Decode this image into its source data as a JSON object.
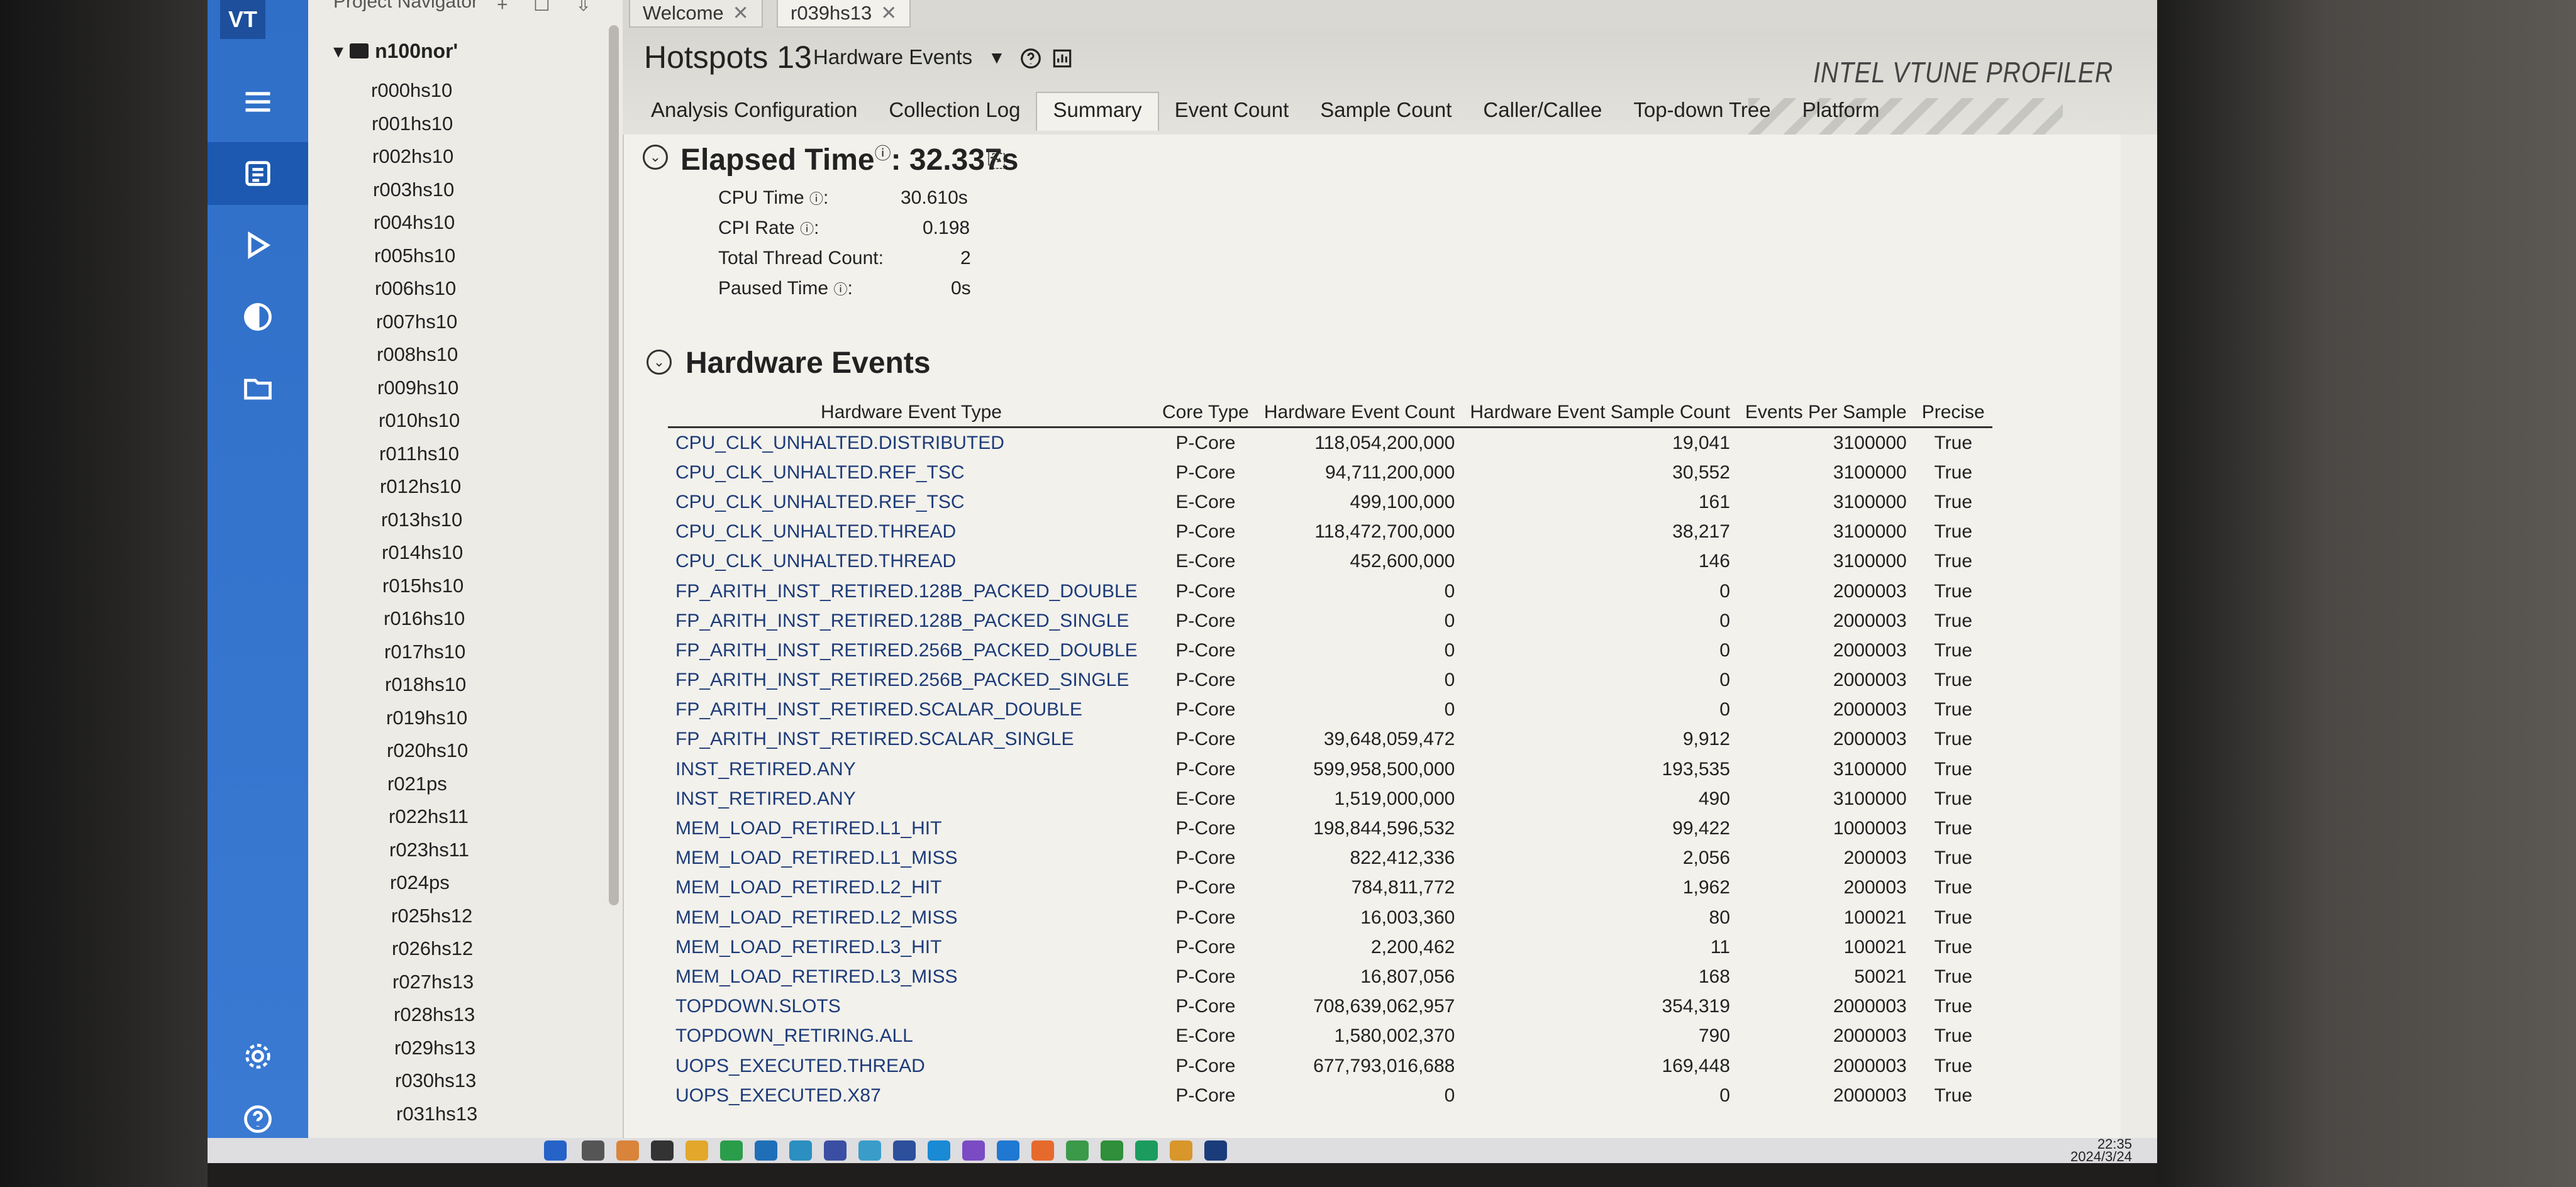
{
  "app": {
    "logo": "VT",
    "brand": "INTEL VTUNE PROFILER"
  },
  "window_tabs": [
    {
      "label": "Welcome"
    },
    {
      "label": "r039hs13"
    }
  ],
  "navigator": {
    "title": "Project Navigator",
    "root": "n100nor'",
    "results": [
      "r000hs10",
      "r001hs10",
      "r002hs10",
      "r003hs10",
      "r004hs10",
      "r005hs10",
      "r006hs10",
      "r007hs10",
      "r008hs10",
      "r009hs10",
      "r010hs10",
      "r011hs10",
      "r012hs10",
      "r013hs10",
      "r014hs10",
      "r015hs10",
      "r016hs10",
      "r017hs10",
      "r018hs10",
      "r019hs10",
      "r020hs10",
      "r021ps",
      "r022hs11",
      "r023hs11",
      "r024ps",
      "r025hs12",
      "r026hs12",
      "r027hs13",
      "r028hs13",
      "r029hs13",
      "r030hs13",
      "r031hs13"
    ]
  },
  "header": {
    "title": "Hotspots 13",
    "view_selector": "Hardware Events",
    "tabs": [
      "Analysis Configuration",
      "Collection Log",
      "Summary",
      "Event Count",
      "Sample Count",
      "Caller/Callee",
      "Top-down Tree",
      "Platform"
    ],
    "active_tab": "Summary"
  },
  "summary": {
    "elapsed_label": "Elapsed Time",
    "elapsed_value": ": 32.337s",
    "metrics": [
      {
        "label": "CPU Time",
        "value": "30.610s"
      },
      {
        "label": "CPI Rate",
        "value": "0.198"
      },
      {
        "label": "Total Thread Count:",
        "value": "2"
      },
      {
        "label": "Paused Time",
        "value": "0s"
      }
    ]
  },
  "hardware_events": {
    "title": "Hardware Events",
    "columns": [
      "Hardware Event Type",
      "Core Type",
      "Hardware Event Count",
      "Hardware Event Sample Count",
      "Events Per Sample",
      "Precise"
    ],
    "rows": [
      [
        "CPU_CLK_UNHALTED.DISTRIBUTED",
        "P-Core",
        "118,054,200,000",
        "19,041",
        "3100000",
        "True"
      ],
      [
        "CPU_CLK_UNHALTED.REF_TSC",
        "P-Core",
        "94,711,200,000",
        "30,552",
        "3100000",
        "True"
      ],
      [
        "CPU_CLK_UNHALTED.REF_TSC",
        "E-Core",
        "499,100,000",
        "161",
        "3100000",
        "True"
      ],
      [
        "CPU_CLK_UNHALTED.THREAD",
        "P-Core",
        "118,472,700,000",
        "38,217",
        "3100000",
        "True"
      ],
      [
        "CPU_CLK_UNHALTED.THREAD",
        "E-Core",
        "452,600,000",
        "146",
        "3100000",
        "True"
      ],
      [
        "FP_ARITH_INST_RETIRED.128B_PACKED_DOUBLE",
        "P-Core",
        "0",
        "0",
        "2000003",
        "True"
      ],
      [
        "FP_ARITH_INST_RETIRED.128B_PACKED_SINGLE",
        "P-Core",
        "0",
        "0",
        "2000003",
        "True"
      ],
      [
        "FP_ARITH_INST_RETIRED.256B_PACKED_DOUBLE",
        "P-Core",
        "0",
        "0",
        "2000003",
        "True"
      ],
      [
        "FP_ARITH_INST_RETIRED.256B_PACKED_SINGLE",
        "P-Core",
        "0",
        "0",
        "2000003",
        "True"
      ],
      [
        "FP_ARITH_INST_RETIRED.SCALAR_DOUBLE",
        "P-Core",
        "0",
        "0",
        "2000003",
        "True"
      ],
      [
        "FP_ARITH_INST_RETIRED.SCALAR_SINGLE",
        "P-Core",
        "39,648,059,472",
        "9,912",
        "2000003",
        "True"
      ],
      [
        "INST_RETIRED.ANY",
        "P-Core",
        "599,958,500,000",
        "193,535",
        "3100000",
        "True"
      ],
      [
        "INST_RETIRED.ANY",
        "E-Core",
        "1,519,000,000",
        "490",
        "3100000",
        "True"
      ],
      [
        "MEM_LOAD_RETIRED.L1_HIT",
        "P-Core",
        "198,844,596,532",
        "99,422",
        "1000003",
        "True"
      ],
      [
        "MEM_LOAD_RETIRED.L1_MISS",
        "P-Core",
        "822,412,336",
        "2,056",
        "200003",
        "True"
      ],
      [
        "MEM_LOAD_RETIRED.L2_HIT",
        "P-Core",
        "784,811,772",
        "1,962",
        "200003",
        "True"
      ],
      [
        "MEM_LOAD_RETIRED.L2_MISS",
        "P-Core",
        "16,003,360",
        "80",
        "100021",
        "True"
      ],
      [
        "MEM_LOAD_RETIRED.L3_HIT",
        "P-Core",
        "2,200,462",
        "11",
        "100021",
        "True"
      ],
      [
        "MEM_LOAD_RETIRED.L3_MISS",
        "P-Core",
        "16,807,056",
        "168",
        "50021",
        "True"
      ],
      [
        "TOPDOWN.SLOTS",
        "P-Core",
        "708,639,062,957",
        "354,319",
        "2000003",
        "True"
      ],
      [
        "TOPDOWN_RETIRING.ALL",
        "E-Core",
        "1,580,002,370",
        "790",
        "2000003",
        "True"
      ],
      [
        "UOPS_EXECUTED.THREAD",
        "P-Core",
        "677,793,016,688",
        "169,448",
        "2000003",
        "True"
      ],
      [
        "UOPS_EXECUTED.X87",
        "P-Core",
        "0",
        "0",
        "2000003",
        "True"
      ]
    ]
  },
  "taskbar": {
    "time": "22:35",
    "date": "2024/3/24"
  },
  "colors": {
    "activity_bar": "#3a7ad3",
    "event_name": "#1d3b78"
  }
}
